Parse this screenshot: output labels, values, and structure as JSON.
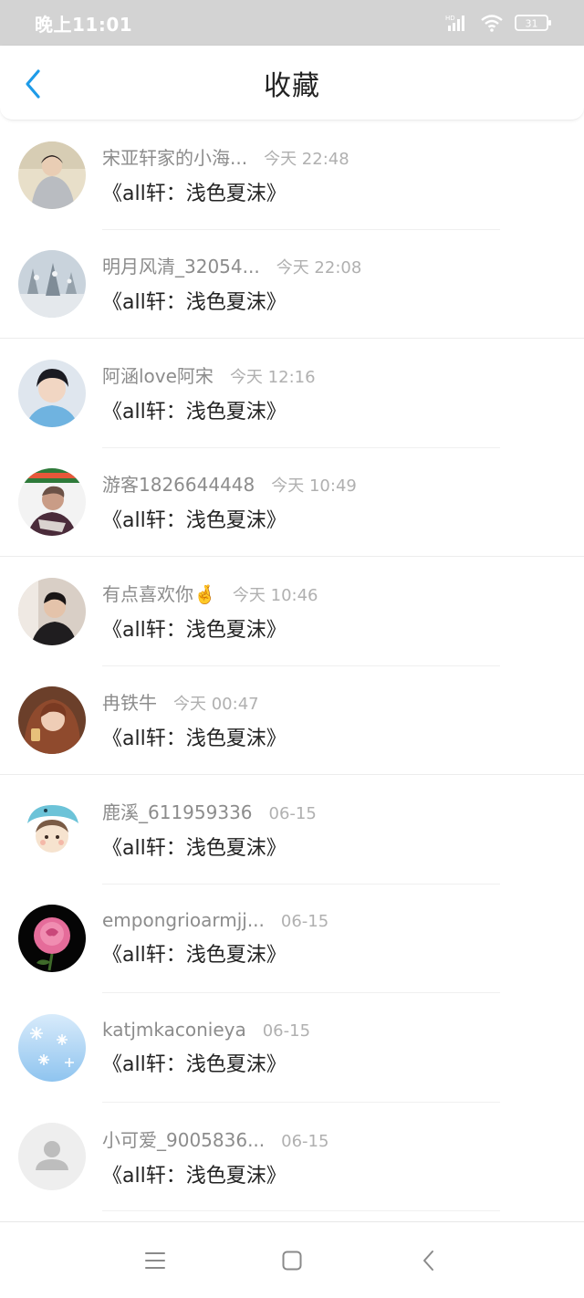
{
  "status_bar": {
    "time": "晚上11:01",
    "signal_label": "HD",
    "battery": "31"
  },
  "header": {
    "title": "收藏"
  },
  "items": [
    {
      "username": "宋亚轩家的小海...",
      "time": "今天 22:48",
      "work": "《all轩：浅色夏沫》",
      "avatar": "photo-boy-grey-hoodie"
    },
    {
      "username": "明月风清_32054...",
      "time": "今天 22:08",
      "work": "《all轩：浅色夏沫》",
      "avatar": "photo-snowy-trees"
    },
    {
      "username": "阿涵love阿宋",
      "time": "今天 12:16",
      "work": "《all轩：浅色夏沫》",
      "avatar": "photo-boy-portrait"
    },
    {
      "username": "游客1826644448",
      "time": "今天 10:49",
      "work": "《all轩：浅色夏沫》",
      "avatar": "photo-man-scarf"
    },
    {
      "username": "有点喜欢你🤞",
      "time": "今天 10:46",
      "work": "《all轩：浅色夏沫》",
      "avatar": "photo-boy-dark"
    },
    {
      "username": "冉铁牛",
      "time": "今天 00:47",
      "work": "《all轩：浅色夏沫》",
      "avatar": "photo-girl-auburn"
    },
    {
      "username": "鹿溪_611959336",
      "time": "06-15",
      "work": "《all轩：浅色夏沫》",
      "avatar": "cartoon-whale-hat"
    },
    {
      "username": "empongrioarmjj...",
      "time": "06-15",
      "work": "《all轩：浅色夏沫》",
      "avatar": "photo-pink-rose"
    },
    {
      "username": "katjmkaconieya",
      "time": "06-15",
      "work": "《all轩：浅色夏沫》",
      "avatar": "snowflakes-blue"
    },
    {
      "username": "小可爱_9005836...",
      "time": "06-15",
      "work": "《all轩：浅色夏沫》",
      "avatar": "default-person"
    }
  ],
  "colors": {
    "accent": "#1e9be8",
    "status_bar_bg": "#d3d3d3"
  }
}
